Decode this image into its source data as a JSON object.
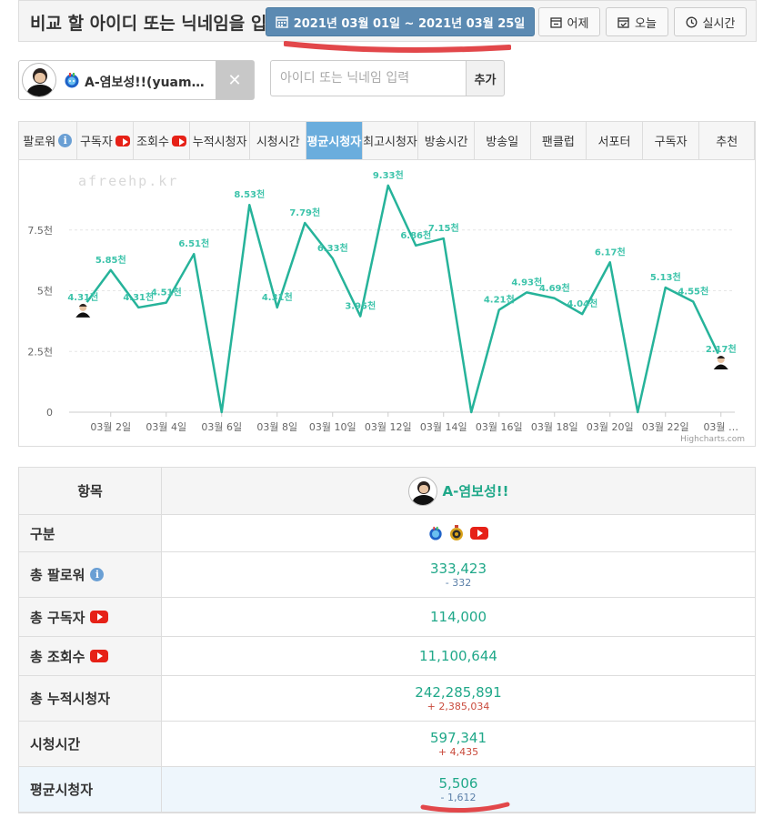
{
  "header": {
    "title": "비교 할 아이디 또는 닉네임을 입력",
    "date_range": "2021년 03월 01일 ~ 2021년 03월 25일",
    "yesterday_label": "어제",
    "today_label": "오늘",
    "realtime_label": "실시간"
  },
  "streamer_chip": {
    "name": "A-염보성!!(yuam…"
  },
  "search": {
    "placeholder": "아이디 또는 닉네임 입력",
    "add_label": "추가"
  },
  "tabs": [
    {
      "label": "팔로워",
      "icon": "info-icon"
    },
    {
      "label": "구독자",
      "icon": "youtube-icon"
    },
    {
      "label": "조회수",
      "icon": "youtube-icon"
    },
    {
      "label": "누적시청자",
      "icon": ""
    },
    {
      "label": "시청시간",
      "icon": ""
    },
    {
      "label": "평균시청자",
      "icon": "",
      "active": true
    },
    {
      "label": "최고시청자",
      "icon": ""
    },
    {
      "label": "방송시간",
      "icon": ""
    },
    {
      "label": "방송일",
      "icon": ""
    },
    {
      "label": "팬클럽",
      "icon": ""
    },
    {
      "label": "서포터",
      "icon": ""
    },
    {
      "label": "구독자",
      "icon": ""
    },
    {
      "label": "추천",
      "icon": ""
    }
  ],
  "chart_data": {
    "type": "line",
    "title": "",
    "xlabel": "",
    "ylabel": "",
    "watermark": "afreehp.kr",
    "credits": "Highcharts.com",
    "ylim": [
      0,
      10000
    ],
    "yticks": [
      "0",
      "2.5천",
      "5천",
      "7.5천"
    ],
    "x_tick_labels": [
      "03월 2일",
      "03월 4일",
      "03월 6일",
      "03월 8일",
      "03월 10일",
      "03월 12일",
      "03월 14일",
      "03월 16일",
      "03월 18일",
      "03월 20일",
      "03월 22일",
      "03월 …"
    ],
    "color": "#26b39a",
    "series": [
      {
        "x": [
          "03월 1일",
          "03월 2일",
          "03월 3일",
          "03월 4일",
          "03월 5일",
          "03월 6일",
          "03월 7일",
          "03월 8일",
          "03월 9일",
          "03월 10일",
          "03월 11일",
          "03월 12일",
          "03월 13일",
          "03월 14일",
          "03월 15일",
          "03월 16일",
          "03월 17일",
          "03월 18일",
          "03월 19일",
          "03월 20일",
          "03월 21일",
          "03월 22일",
          "03월 23일",
          "03월 24일"
        ],
        "values": [
          4310,
          5850,
          4310,
          4510,
          6510,
          0,
          8530,
          4310,
          7790,
          6330,
          3950,
          9330,
          6860,
          7150,
          0,
          4210,
          4930,
          4690,
          4040,
          6170,
          0,
          5130,
          4550,
          2170
        ],
        "labels": [
          "4.31천",
          "5.85천",
          "4.31천",
          "4.51천",
          "6.51천",
          "",
          "8.53천",
          "4.31천",
          "7.79천",
          "6.33천",
          "3.95천",
          "9.33천",
          "6.86천",
          "7.15천",
          "",
          "4.21천",
          "4.93천",
          "4.69천",
          "4.04천",
          "6.17천",
          "",
          "5.13천",
          "4.55천",
          "2.17천"
        ]
      }
    ]
  },
  "table": {
    "header_label": "항목",
    "header_name": "A-염보성!!",
    "rows": [
      {
        "label": "구분",
        "icon": "",
        "main": "",
        "sub": "",
        "sub_type": ""
      },
      {
        "label": "총 팔로워",
        "icon": "info-icon",
        "main": "333,423",
        "sub": "- 332",
        "sub_type": "down"
      },
      {
        "label": "총 구독자",
        "icon": "youtube-icon",
        "main": "114,000",
        "sub": "",
        "sub_type": ""
      },
      {
        "label": "총 조회수",
        "icon": "youtube-icon",
        "main": "11,100,644",
        "sub": "",
        "sub_type": ""
      },
      {
        "label": "총 누적시청자",
        "icon": "",
        "main": "242,285,891",
        "sub": "+ 2,385,034",
        "sub_type": "up"
      },
      {
        "label": "시청시간",
        "icon": "",
        "main": "597,341",
        "sub": "+ 4,435",
        "sub_type": "up"
      },
      {
        "label": "평균시청자",
        "icon": "",
        "main": "5,506",
        "sub": "- 1,612",
        "sub_type": "down"
      }
    ]
  }
}
